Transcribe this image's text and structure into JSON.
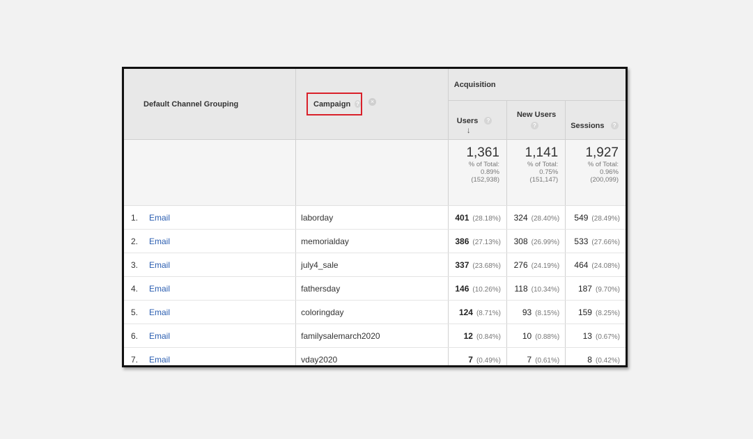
{
  "headers": {
    "dimension": "Default Channel Grouping",
    "campaign": "Campaign",
    "group": "Acquisition",
    "users": "Users",
    "new_users": "New Users",
    "sessions": "Sessions"
  },
  "icons": {
    "help": "?",
    "remove": "×",
    "sort": "↓"
  },
  "totals": {
    "users": {
      "value": "1,361",
      "label": "% of Total:",
      "pct": "0.89%",
      "total": "(152,938)"
    },
    "new_users": {
      "value": "1,141",
      "label": "% of Total:",
      "pct": "0.75%",
      "total": "(151,147)"
    },
    "sessions": {
      "value": "1,927",
      "label": "% of Total:",
      "pct": "0.96%",
      "total": "(200,099)"
    }
  },
  "rows": [
    {
      "rank": "1.",
      "channel": "Email",
      "campaign": "laborday",
      "users": "401",
      "users_pct": "(28.18%)",
      "new_users": "324",
      "new_users_pct": "(28.40%)",
      "sessions": "549",
      "sessions_pct": "(28.49%)"
    },
    {
      "rank": "2.",
      "channel": "Email",
      "campaign": "memorialday",
      "users": "386",
      "users_pct": "(27.13%)",
      "new_users": "308",
      "new_users_pct": "(26.99%)",
      "sessions": "533",
      "sessions_pct": "(27.66%)"
    },
    {
      "rank": "3.",
      "channel": "Email",
      "campaign": "july4_sale",
      "users": "337",
      "users_pct": "(23.68%)",
      "new_users": "276",
      "new_users_pct": "(24.19%)",
      "sessions": "464",
      "sessions_pct": "(24.08%)"
    },
    {
      "rank": "4.",
      "channel": "Email",
      "campaign": "fathersday",
      "users": "146",
      "users_pct": "(10.26%)",
      "new_users": "118",
      "new_users_pct": "(10.34%)",
      "sessions": "187",
      "sessions_pct": "(9.70%)"
    },
    {
      "rank": "5.",
      "channel": "Email",
      "campaign": "coloringday",
      "users": "124",
      "users_pct": "(8.71%)",
      "new_users": "93",
      "new_users_pct": "(8.15%)",
      "sessions": "159",
      "sessions_pct": "(8.25%)"
    },
    {
      "rank": "6.",
      "channel": "Email",
      "campaign": "familysalemarch2020",
      "users": "12",
      "users_pct": "(0.84%)",
      "new_users": "10",
      "new_users_pct": "(0.88%)",
      "sessions": "13",
      "sessions_pct": "(0.67%)"
    },
    {
      "rank": "7.",
      "channel": "Email",
      "campaign": "vday2020",
      "users": "7",
      "users_pct": "(0.49%)",
      "new_users": "7",
      "new_users_pct": "(0.61%)",
      "sessions": "8",
      "sessions_pct": "(0.42%)"
    }
  ]
}
